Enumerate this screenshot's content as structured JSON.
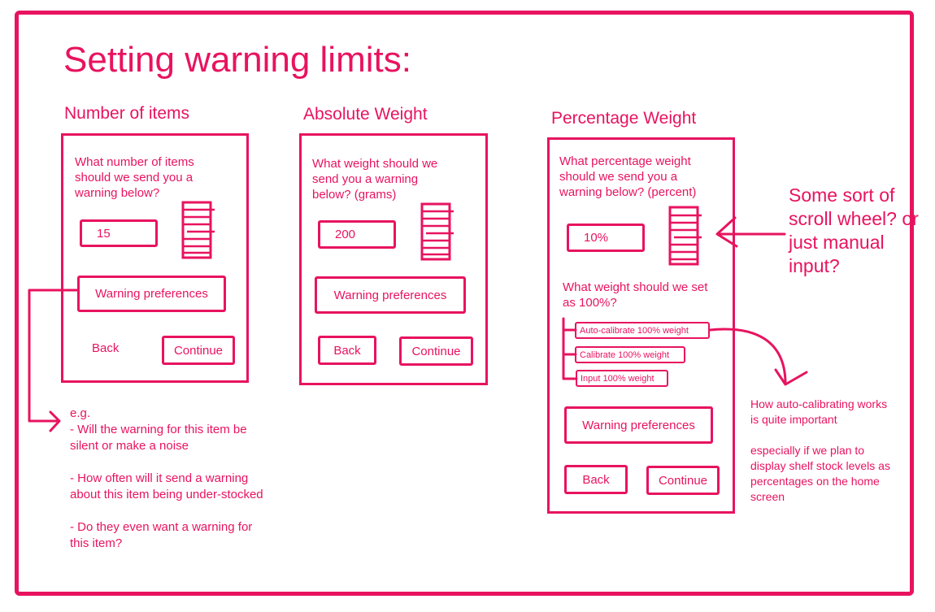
{
  "title": "Setting warning limits:",
  "columns": {
    "items": {
      "heading": "Number of items",
      "question": "What number of items should we send you a warning below?",
      "value": "15",
      "preferences": "Warning preferences",
      "back": "Back",
      "continue": "Continue"
    },
    "absolute": {
      "heading": "Absolute Weight",
      "question": "What weight should we send you a warning below? (grams)",
      "value": "200",
      "preferences": "Warning preferences",
      "back": "Back",
      "continue": "Continue"
    },
    "percentage": {
      "heading": "Percentage Weight",
      "question": "What percentage weight should we send you a warning below? (percent)",
      "value": "10%",
      "question2": "What weight should we set as 100%?",
      "options": [
        "Auto-calibrate 100% weight",
        "Calibrate 100% weight",
        "Input 100% weight"
      ],
      "preferences": "Warning preferences",
      "back": "Back",
      "continue": "Continue"
    }
  },
  "notes": {
    "eg": "e.g.",
    "eg1": "- Will the warning for this item be silent or make a noise",
    "eg2": "- How often will it send a warning about this item being under-stocked",
    "eg3": "- Do they even want a warning for this item?",
    "scroll": "Some sort of scroll wheel? or just manual input?",
    "auto1": "How auto-calibrating works is quite important",
    "auto2": "especially if we plan to display shelf stock levels as percentages on the home screen"
  },
  "colors": {
    "accent": "#e8135f",
    "background": "#ffffff"
  }
}
